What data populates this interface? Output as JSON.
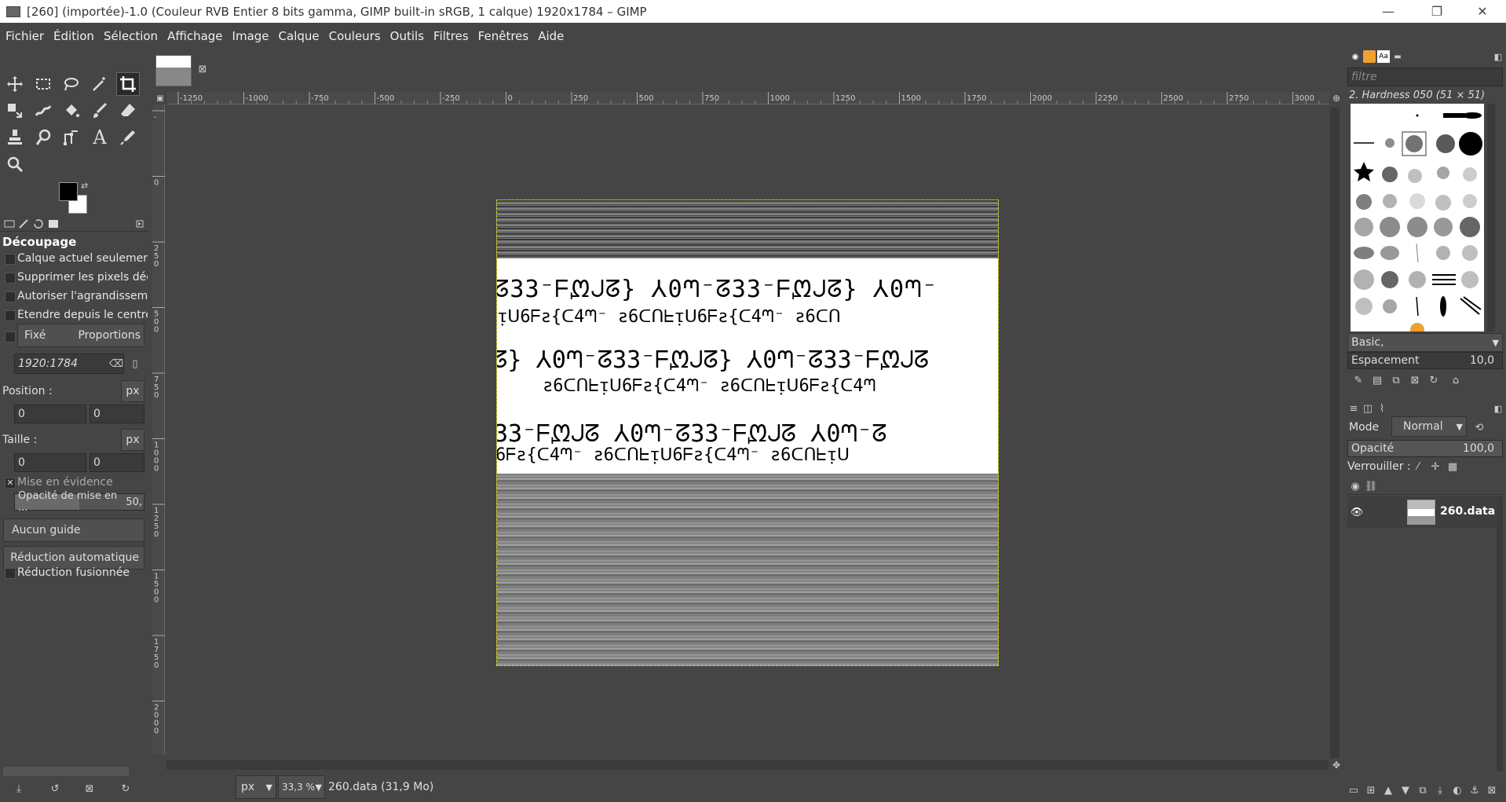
{
  "window": {
    "title": "[260] (importée)-1.0 (Couleur RVB Entier 8 bits gamma, GIMP built-in sRGB, 1 calque) 1920x1784 – GIMP",
    "min_glyph": "—",
    "max_glyph": "❐",
    "close_glyph": "✕"
  },
  "menu": [
    "Fichier",
    "Édition",
    "Sélection",
    "Affichage",
    "Image",
    "Calque",
    "Couleurs",
    "Outils",
    "Filtres",
    "Fenêtres",
    "Aide"
  ],
  "tools": [
    "move-tool-icon",
    "rect-select-icon",
    "lasso-icon",
    "fuzzy-select-icon",
    "crop-tool-icon",
    "transform-icon",
    "warp-icon",
    "bucket-fill-icon",
    "paintbrush-icon",
    "eraser-icon",
    "clone-icon",
    "smudge-icon",
    "paths-icon",
    "text-tool-icon",
    "color-picker-icon",
    "zoom-icon"
  ],
  "colors": {
    "foreground": "#000000",
    "background": "#ffffff",
    "selection": "#d4d400"
  },
  "tool_options": {
    "title": "Découpage",
    "current_layer_only": "Calque actuel seulement",
    "delete_pixels": "Supprimer les pixels décou",
    "allow_growing": "Autoriser l'agrandissement",
    "expand_center": "Étendre depuis le centre",
    "fixed": "Fixé",
    "proportions": "Proportions",
    "ratio": "1920:1784",
    "position_label": "Position :",
    "position_unit": "px",
    "pos_x": "0",
    "pos_y": "0",
    "size_label": "Taille :",
    "size_unit": "px",
    "size_w": "0",
    "size_h": "0",
    "highlight": "Mise en évidence",
    "highlight_opacity_label": "Opacité de mise en ...",
    "highlight_opacity_value": "50,",
    "guides": "Aucun guide",
    "auto_shrink": "Réduction automatique",
    "shrink_merged": "Réduction fusionnée"
  },
  "rulers": {
    "h_ticks": [
      "-1250",
      "-1000",
      "-750",
      "-500",
      "-250",
      "0",
      "250",
      "500",
      "750",
      "1000",
      "1250",
      "1500",
      "1750",
      "2000",
      "2250",
      "2500",
      "2750",
      "3000"
    ],
    "v_ticks": [
      "-",
      "0",
      "250",
      "500",
      "750",
      "1000",
      "1250",
      "1500",
      "1750",
      "2000"
    ]
  },
  "image": {
    "text_rows": [
      "ᘔ33⁻ᖴᘻᒍᘔ}  ⅄0ᘉ⁻ᘔ33⁻ᖴᘻᒍᘔ}  ⅄0ᘉ⁻",
      "ᴉᑌ6ᖴƨ{ᑕ4ᘉ⁻  ƨ6ᑕᑎᖶᴉᑌ6ᖴƨ{ᑕ4ᘉ⁻  ƨ6ᑕᑎ",
      "ᘔ}  ⅄0ᘉ⁻ᘔ33⁻ᖴᘻᒍᘔ}  ⅄0ᘉ⁻ᘔ33⁻ᖴᘻᒍᘔ",
      "ƨ6ᑕᑎᖶᴉᑌ6ᖴƨ{ᑕ4ᘉ⁻  ƨ6ᑕᑎᖶᴉᑌ6ᖴƨ{ᑕ4ᘉ",
      "33⁻ᖴᘻᒍᘔ  ⅄0ᘉ⁻ᘔ33⁻ᖴᘻᒍᘔ  ⅄0ᘉ⁻ᘔ",
      "6ᖴƨ{ᑕ4ᘉ⁻  ƨ6ᑕᑎᖶᴉᑌ6ᖴƨ{ᑕ4ᘉ⁻  ƨ6ᑕᑎᖶᴉᑌ"
    ]
  },
  "status": {
    "unit": "px",
    "zoom": "33,3 %",
    "file": "260.data (31,9 Mo)"
  },
  "brushes": {
    "filter_placeholder": "filtre",
    "current": "2. Hardness 050 (51 × 51)",
    "preset": "Basic,",
    "spacing_label": "Espacement",
    "spacing_value": "10,0"
  },
  "layers": {
    "mode_label": "Mode",
    "mode_value": "Normal",
    "opacity_label": "Opacité",
    "opacity_value": "100,0",
    "lock_label": "Verrouiller :",
    "layer_name": "260.data"
  }
}
